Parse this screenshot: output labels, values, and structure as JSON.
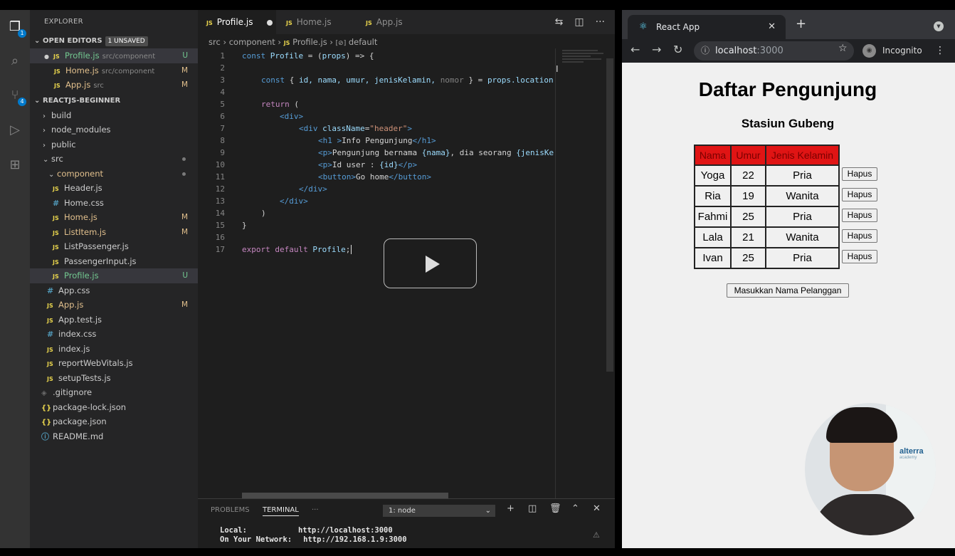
{
  "explorer": {
    "title": "EXPLORER",
    "open_editors_label": "OPEN EDITORS",
    "unsaved_badge": "1 UNSAVED",
    "open_editors": [
      {
        "name": "Profile.js",
        "path": "src/component",
        "status": "U"
      },
      {
        "name": "Home.js",
        "path": "src/component",
        "status": "M"
      },
      {
        "name": "App.js",
        "path": "src",
        "status": "M"
      }
    ],
    "project_label": "REACTJS-BEGINNER",
    "tree": [
      {
        "name": "build"
      },
      {
        "name": "node_modules"
      },
      {
        "name": "public"
      },
      {
        "name": "src"
      },
      {
        "name": "component"
      },
      {
        "name": "Header.js"
      },
      {
        "name": "Home.css"
      },
      {
        "name": "Home.js",
        "status": "M"
      },
      {
        "name": "ListItem.js",
        "status": "M"
      },
      {
        "name": "ListPassenger.js"
      },
      {
        "name": "PassengerInput.js"
      },
      {
        "name": "Profile.js",
        "status": "U"
      },
      {
        "name": "App.css"
      },
      {
        "name": "App.js",
        "status": "M"
      },
      {
        "name": "App.test.js"
      },
      {
        "name": "index.css"
      },
      {
        "name": "index.js"
      },
      {
        "name": "reportWebVitals.js"
      },
      {
        "name": "setupTests.js"
      },
      {
        "name": ".gitignore"
      },
      {
        "name": "package-lock.json"
      },
      {
        "name": "package.json"
      },
      {
        "name": "README.md"
      }
    ],
    "activity_badges": {
      "explorer": "1",
      "scm": "4"
    }
  },
  "tabs": [
    {
      "label": "Profile.js"
    },
    {
      "label": "Home.js"
    },
    {
      "label": "App.js"
    }
  ],
  "breadcrumb": {
    "seg1": "src",
    "seg2": "component",
    "seg3": "Profile.js",
    "seg4": "default"
  },
  "code_lines": [
    "1",
    "2",
    "3",
    "4",
    "5",
    "6",
    "7",
    "8",
    "9",
    "10",
    "11",
    "12",
    "13",
    "14",
    "15",
    "16",
    "17"
  ],
  "code": {
    "l1_const": "const",
    "l1_name": "Profile",
    "l1_rest": "= (",
    "l1_param": "props",
    "l1_end": ") => {",
    "l3_const": "const",
    "l3_open": "{",
    "l3_vars": "id, nama, umur, jenisKelamin,",
    "l3_nomor": "nomor",
    "l3_close": "} =",
    "l3_props": "props.location",
    "l5_return": "return",
    "l5_paren": "(",
    "l6": "<div>",
    "l7_open": "<div",
    "l7_attr": "className",
    "l7_eq": "=",
    "l7_str": "\"header\"",
    "l7_close": ">",
    "l8_open": "<h1 >",
    "l8_text": "Info Pengunjung",
    "l8_close": "</h1>",
    "l9_open": "<p>",
    "l9_text": "Pengunjung bernama",
    "l9_expr": "{nama}",
    "l9_text2": ", dia seorang",
    "l9_expr2": "{jenisKe",
    "l10_open": "<p>",
    "l10_text": "Id user : ",
    "l10_expr": "{id}",
    "l10_close": "</p>",
    "l11_open": "<button>",
    "l11_text": "Go home",
    "l11_close": "</button>",
    "l12": "</div>",
    "l13": "</div>",
    "l14": ")",
    "l15": "}",
    "l17_export": "export default",
    "l17_name": "Profile",
    "l17_semi": ";"
  },
  "panel": {
    "problems": "PROBLEMS",
    "terminal": "TERMINAL",
    "more": "···",
    "terminal_select": "1: node",
    "line1_label": "Local:",
    "line1_url": "http://localhost:3000",
    "line2_label": "On Your Network:",
    "line2_url": "http://192.168.1.9:3000"
  },
  "browser": {
    "tab_title": "React App",
    "url_host": "localhost",
    "url_port": ":3000",
    "incognito": "Incognito"
  },
  "page": {
    "title": "Daftar Pengunjung",
    "subtitle": "Stasiun Gubeng",
    "columns": [
      "Nama",
      "Umur",
      "Jenis Kelamin"
    ],
    "rows": [
      [
        "Yoga",
        "22",
        "Pria"
      ],
      [
        "Ria",
        "19",
        "Wanita"
      ],
      [
        "Fahmi",
        "25",
        "Pria"
      ],
      [
        "Lala",
        "21",
        "Wanita"
      ],
      [
        "Ivan",
        "25",
        "Pria"
      ]
    ],
    "delete_label": "Hapus",
    "add_button": "Masukkan Nama Pelanggan"
  },
  "webcam": {
    "logo": "alterra",
    "logo_sub": "academy"
  },
  "colors": {
    "table_header_bg": "#e01414",
    "vscode_accent": "#007acc"
  }
}
